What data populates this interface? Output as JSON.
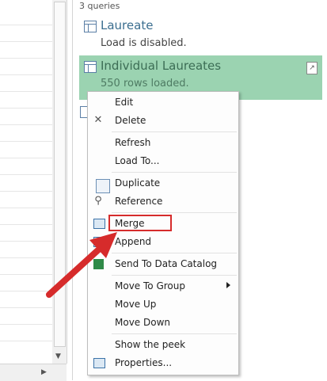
{
  "queries_pane": {
    "count_label": "3 queries",
    "items": [
      {
        "name": "Laureate",
        "status": "Load is disabled."
      },
      {
        "name": "Individual Laureates",
        "status": "550 rows loaded.",
        "selected": true
      }
    ]
  },
  "context_menu": {
    "items": [
      {
        "id": "edit",
        "label": "Edit",
        "icon": ""
      },
      {
        "id": "delete",
        "label": "Delete",
        "icon": "close-icon"
      },
      {
        "id": "refresh",
        "label": "Refresh",
        "icon": ""
      },
      {
        "id": "load_to",
        "label": "Load To...",
        "icon": ""
      },
      {
        "id": "duplicate",
        "label": "Duplicate",
        "icon": "duplicate-icon"
      },
      {
        "id": "reference",
        "label": "Reference",
        "icon": "paperclip-icon"
      },
      {
        "id": "merge",
        "label": "Merge",
        "icon": "merge-icon",
        "highlighted": true
      },
      {
        "id": "append",
        "label": "Append",
        "icon": "append-icon"
      },
      {
        "id": "send_to_catalog",
        "label": "Send To Data Catalog",
        "icon": "data-catalog-icon"
      },
      {
        "id": "move_to_group",
        "label": "Move To Group",
        "icon": "",
        "submenu": true
      },
      {
        "id": "move_up",
        "label": "Move Up",
        "icon": ""
      },
      {
        "id": "move_down",
        "label": "Move Down",
        "icon": ""
      },
      {
        "id": "show_peek",
        "label": "Show the peek",
        "icon": ""
      },
      {
        "id": "properties",
        "label": "Properties...",
        "icon": "properties-icon"
      }
    ]
  },
  "colors": {
    "selected_row": "#9bd3b1",
    "annotation": "#d62b2b",
    "query_name": "#3b6e8f"
  }
}
